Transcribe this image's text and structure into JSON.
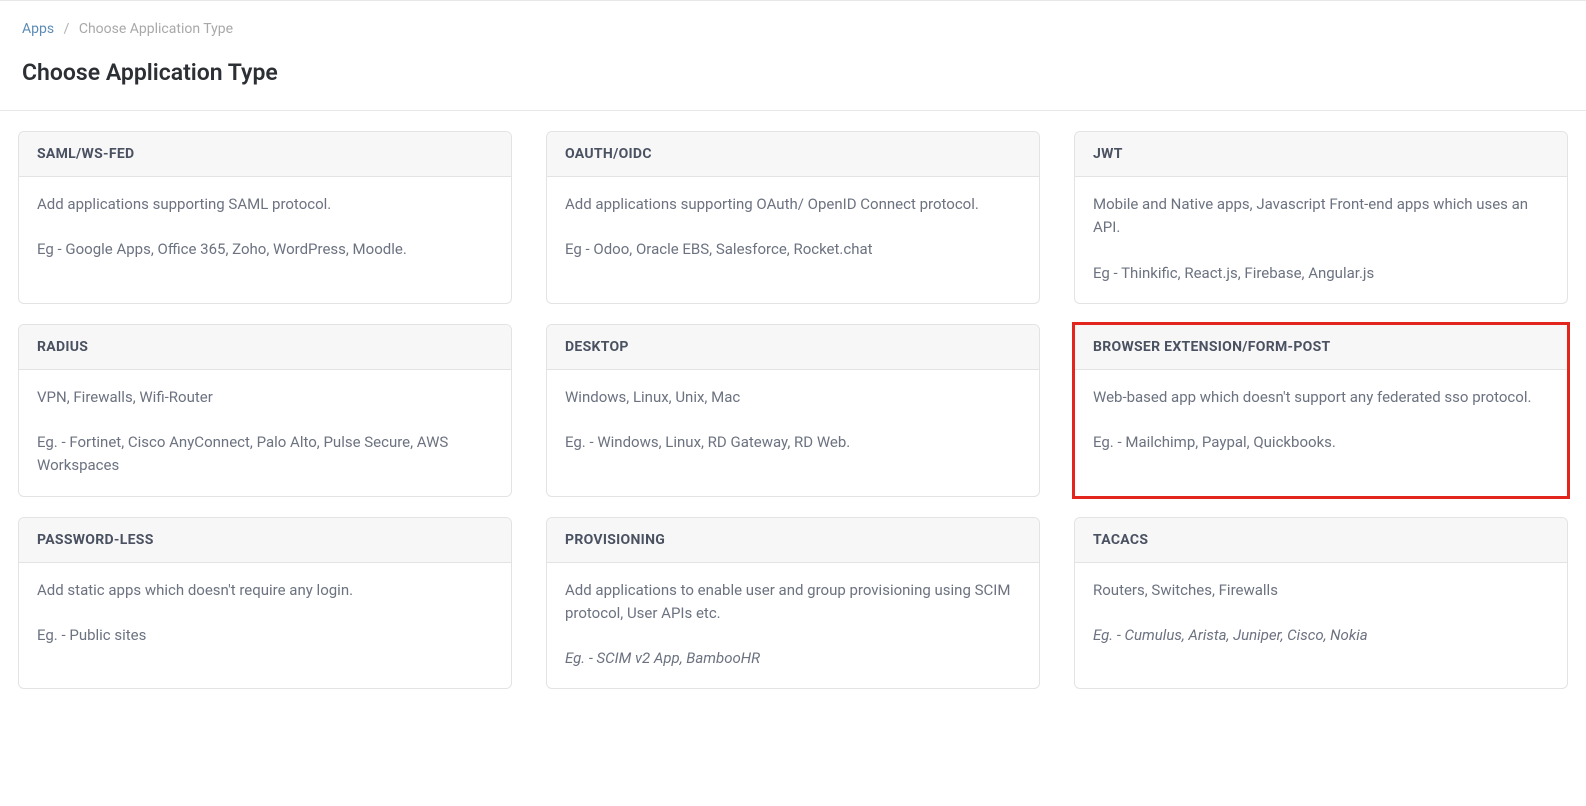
{
  "breadcrumb": {
    "root": "Apps",
    "current": "Choose Application Type"
  },
  "title": "Choose Application Type",
  "cards": [
    {
      "header": "SAML/WS-FED",
      "desc": "Add applications supporting SAML protocol.",
      "eg": "Eg - Google Apps, Office 365, Zoho, WordPress, Moodle."
    },
    {
      "header": "OAUTH/OIDC",
      "desc": "Add applications supporting OAuth/ OpenID Connect protocol.",
      "eg": "Eg - Odoo, Oracle EBS, Salesforce, Rocket.chat"
    },
    {
      "header": "JWT",
      "desc": "Mobile and Native apps, Javascript Front-end apps which uses an API.",
      "eg": "Eg - Thinkific, React.js, Firebase, Angular.js"
    },
    {
      "header": "RADIUS",
      "desc": "VPN, Firewalls, Wifi-Router",
      "eg": "Eg. - Fortinet, Cisco AnyConnect, Palo Alto, Pulse Secure, AWS Workspaces"
    },
    {
      "header": "DESKTOP",
      "desc": "Windows, Linux, Unix, Mac",
      "eg": "Eg. - Windows, Linux, RD Gateway, RD Web."
    },
    {
      "header": "BROWSER EXTENSION/FORM-POST",
      "desc": "Web-based app which doesn't support any federated sso protocol.",
      "eg": "Eg. - Mailchimp, Paypal, Quickbooks."
    },
    {
      "header": "PASSWORD-LESS",
      "desc": "Add static apps which doesn't require any login.",
      "eg": "Eg. - Public sites"
    },
    {
      "header": "PROVISIONING",
      "desc": "Add applications to enable user and group provisioning using SCIM protocol, User APIs etc.",
      "eg": "Eg. - SCIM v2 App, BambooHR"
    },
    {
      "header": "TACACS",
      "desc": "Routers, Switches, Firewalls",
      "eg": "Eg. - Cumulus, Arista, Juniper, Cisco, Nokia"
    }
  ],
  "highlightedIndex": 5,
  "italicEgIndices": [
    7,
    8
  ]
}
